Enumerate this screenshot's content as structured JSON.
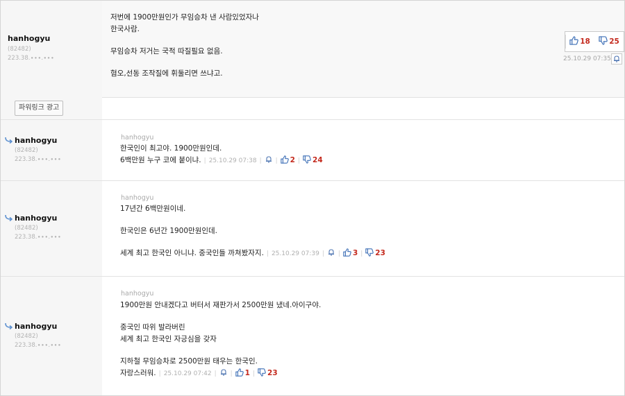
{
  "main_comment": {
    "user": "hanhogyu",
    "user_id": "(82482)",
    "ip": "223.38.∙∙∙.∙∙∙",
    "lines": [
      "저번에 1900만원인가 무임승차 낸 사람있었자나",
      "한국사람.",
      "",
      "무임승차 저거는 국적 따질필요 없음.",
      "",
      "혐오,선동 조작질에 휘둘리면 쓰냐고."
    ],
    "up": "18",
    "down": "25",
    "time": "25.10.29 07:35"
  },
  "ad": {
    "label": "파워링크 광고"
  },
  "replies": [
    {
      "user": "hanhogyu",
      "user_id": "(82482)",
      "ip": "223.38.∙∙∙.∙∙∙",
      "reply_to": "hanhogyu",
      "lines": [
        "한국인이 최고야. 1900만원인데.",
        "6백만원 누구 코에 붙이냐."
      ],
      "time": "25.10.29 07:38",
      "up": "2",
      "down": "24"
    },
    {
      "user": "hanhogyu",
      "user_id": "(82482)",
      "ip": "223.38.∙∙∙.∙∙∙",
      "reply_to": "hanhogyu",
      "lines": [
        "17년간 6백만원이네.",
        "",
        "한국인은 6년간 1900만원인데.",
        "",
        "세계 최고 한국인 아니냐. 중국인들 까쳐봤자지."
      ],
      "time": "25.10.29 07:39",
      "up": "3",
      "down": "23"
    },
    {
      "user": "hanhogyu",
      "user_id": "(82482)",
      "ip": "223.38.∙∙∙.∙∙∙",
      "reply_to": "hanhogyu",
      "lines": [
        "1900만원 안내겠다고 버터서 재판가서 2500만원 냈네.아이구야.",
        "",
        "중국인 따위 발라버린",
        "세계 최고 한국인 자긍심을 갖자",
        "",
        "지하철 무임승차로 2500만원 태우는 한국인.",
        "자랑스러워."
      ],
      "time": "25.10.29 07:42",
      "up": "1",
      "down": "23"
    }
  ],
  "icons": {
    "thumbs_up": "thumbs-up-icon",
    "thumbs_down": "thumbs-down-icon",
    "report": "bell-icon",
    "reply": "reply-arrow-icon"
  },
  "colors": {
    "up_icon": "#3d6fb6",
    "down_icon": "#3d6fb6",
    "count": "#c42a1e"
  }
}
